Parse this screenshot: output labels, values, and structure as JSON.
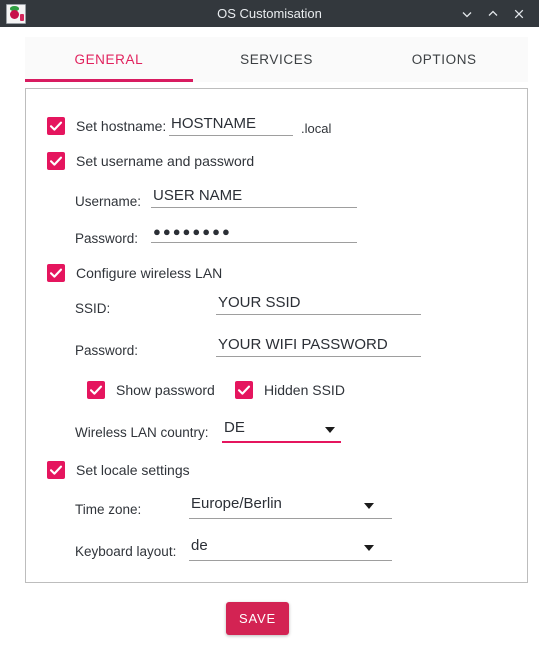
{
  "window": {
    "title": "OS Customisation",
    "icon": "raspberry-pi-icon",
    "controls": [
      {
        "name": "minimize",
        "glyph": "chevron-down-icon"
      },
      {
        "name": "maximize",
        "glyph": "chevron-up-icon"
      },
      {
        "name": "close",
        "glyph": "close-icon"
      }
    ]
  },
  "tabs": [
    {
      "label": "GENERAL",
      "active": true
    },
    {
      "label": "SERVICES",
      "active": false
    },
    {
      "label": "OPTIONS",
      "active": false
    }
  ],
  "form": {
    "hostname": {
      "checkbox_label": "Set hostname:",
      "checked": true,
      "value": "HOSTNAME",
      "suffix": ".local"
    },
    "user": {
      "checkbox_label": "Set username and password",
      "checked": true,
      "username_label": "Username:",
      "username_value": "USER NAME",
      "password_label": "Password:",
      "password_value": "●●●●●●●●"
    },
    "wifi": {
      "checkbox_label": "Configure wireless LAN",
      "checked": true,
      "ssid_label": "SSID:",
      "ssid_value": "YOUR SSID",
      "password_label": "Password:",
      "password_value": "YOUR WIFI PASSWORD",
      "show_password_label": "Show password",
      "show_password_checked": true,
      "hidden_ssid_label": "Hidden SSID",
      "hidden_ssid_checked": true,
      "country_label": "Wireless LAN country:",
      "country_value": "DE"
    },
    "locale": {
      "checkbox_label": "Set locale settings",
      "checked": true,
      "timezone_label": "Time zone:",
      "timezone_value": "Europe/Berlin",
      "keyboard_label": "Keyboard layout:",
      "keyboard_value": "de"
    }
  },
  "actions": {
    "save_label": "SAVE"
  },
  "colors": {
    "accent": "#e5155e",
    "accent_dark": "#d32353",
    "tab_underline": "#d81b60",
    "titlebar": "#33383d"
  }
}
